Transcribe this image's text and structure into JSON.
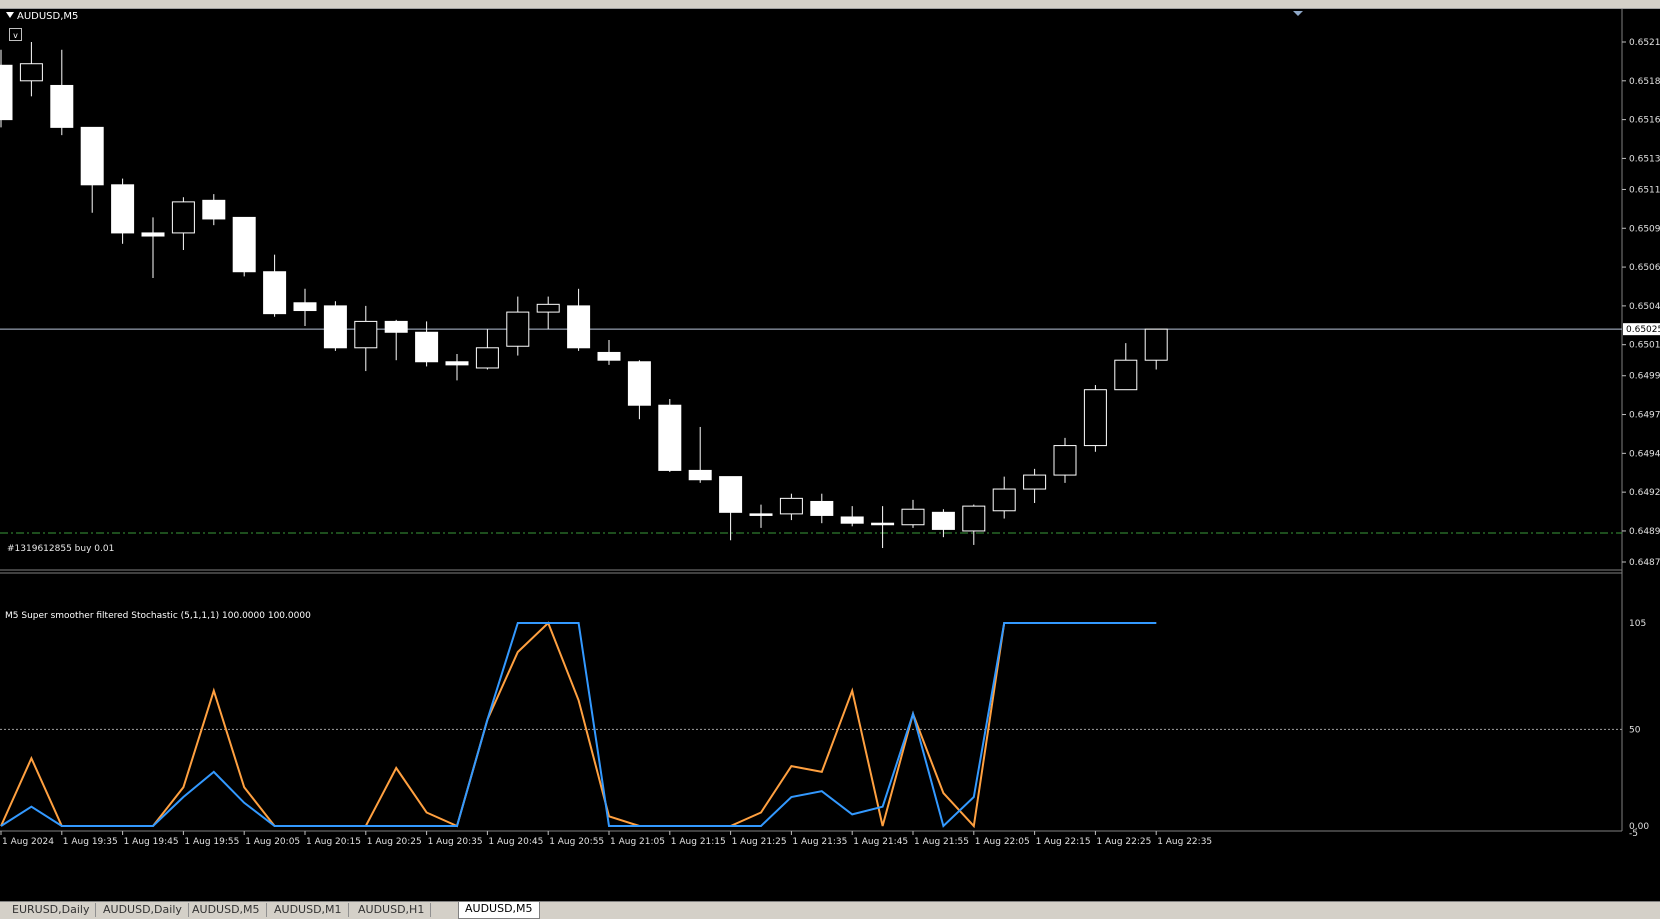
{
  "window": {
    "symbol_title": "AUDUSD,M5",
    "oneclick_toggle": "v"
  },
  "price_axis": {
    "labels": [
      "0.65210",
      "0.65185",
      "0.65160",
      "0.65135",
      "0.65115",
      "0.65090",
      "0.65065",
      "0.65040",
      "0.65015",
      "0.64995",
      "0.64970",
      "0.64945",
      "0.64920",
      "0.64895",
      "0.64875"
    ],
    "current_price": "0.65025"
  },
  "order_line": {
    "label": "#1319612855 buy 0.01",
    "color": "#3a9a3a"
  },
  "indicator": {
    "label": "M5 Super smoother filtered Stochastic (5,1,1,1) 100.0000 100.0000",
    "scale_labels": [
      "105",
      "50",
      "0.00",
      "-5"
    ],
    "main_color": "#3399ff",
    "signal_color": "#ffa040",
    "main_values": [
      0,
      10,
      0,
      0,
      0,
      0,
      15,
      28,
      12,
      0,
      0,
      0,
      0,
      0,
      0,
      0,
      55,
      106,
      106,
      106,
      0,
      0,
      0,
      0,
      0,
      0,
      15,
      18,
      6,
      10,
      58,
      0,
      15,
      106,
      106,
      106,
      106,
      106,
      106
    ],
    "signal_values": [
      0,
      35,
      0,
      0,
      0,
      0,
      20,
      70,
      20,
      0,
      0,
      0,
      0,
      30,
      7,
      0,
      55,
      90,
      106,
      65,
      5,
      0,
      0,
      0,
      0,
      7,
      31,
      28,
      70,
      0,
      58,
      17,
      0,
      106,
      106,
      106,
      106,
      106,
      106
    ]
  },
  "time_axis": {
    "labels": [
      "1 Aug 2024",
      "1 Aug 19:35",
      "1 Aug 19:45",
      "1 Aug 19:55",
      "1 Aug 20:05",
      "1 Aug 20:15",
      "1 Aug 20:25",
      "1 Aug 20:35",
      "1 Aug 20:45",
      "1 Aug 20:55",
      "1 Aug 21:05",
      "1 Aug 21:15",
      "1 Aug 21:25",
      "1 Aug 21:35",
      "1 Aug 21:45",
      "1 Aug 21:55",
      "1 Aug 22:05",
      "1 Aug 22:15",
      "1 Aug 22:25",
      "1 Aug 22:35"
    ]
  },
  "candles": [
    {
      "o": 0.65195,
      "h": 0.65205,
      "l": 0.65155,
      "c": 0.6516
    },
    {
      "o": 0.65185,
      "h": 0.6521,
      "l": 0.65175,
      "c": 0.65196
    },
    {
      "o": 0.65182,
      "h": 0.65205,
      "l": 0.6515,
      "c": 0.65155
    },
    {
      "o": 0.65155,
      "h": 0.65155,
      "l": 0.651,
      "c": 0.65118
    },
    {
      "o": 0.65118,
      "h": 0.65122,
      "l": 0.6508,
      "c": 0.65087
    },
    {
      "o": 0.65087,
      "h": 0.65097,
      "l": 0.65058,
      "c": 0.65085
    },
    {
      "o": 0.65087,
      "h": 0.6511,
      "l": 0.65076,
      "c": 0.65107
    },
    {
      "o": 0.65108,
      "h": 0.65112,
      "l": 0.65092,
      "c": 0.65096
    },
    {
      "o": 0.65097,
      "h": 0.65097,
      "l": 0.65059,
      "c": 0.65062
    },
    {
      "o": 0.65062,
      "h": 0.65073,
      "l": 0.65033,
      "c": 0.65035
    },
    {
      "o": 0.65042,
      "h": 0.65051,
      "l": 0.65027,
      "c": 0.65037
    },
    {
      "o": 0.6504,
      "h": 0.65043,
      "l": 0.65011,
      "c": 0.65013
    },
    {
      "o": 0.65013,
      "h": 0.6504,
      "l": 0.64998,
      "c": 0.6503
    },
    {
      "o": 0.6503,
      "h": 0.65031,
      "l": 0.65005,
      "c": 0.65023
    },
    {
      "o": 0.65023,
      "h": 0.6503,
      "l": 0.65001,
      "c": 0.65004
    },
    {
      "o": 0.65004,
      "h": 0.65009,
      "l": 0.64992,
      "c": 0.65002
    },
    {
      "o": 0.65,
      "h": 0.65025,
      "l": 0.64999,
      "c": 0.65013
    },
    {
      "o": 0.65014,
      "h": 0.65046,
      "l": 0.65008,
      "c": 0.65036
    },
    {
      "o": 0.65036,
      "h": 0.65046,
      "l": 0.65025,
      "c": 0.65041
    },
    {
      "o": 0.6504,
      "h": 0.65051,
      "l": 0.65011,
      "c": 0.65013
    },
    {
      "o": 0.6501,
      "h": 0.65018,
      "l": 0.65002,
      "c": 0.65005
    },
    {
      "o": 0.65004,
      "h": 0.65005,
      "l": 0.64967,
      "c": 0.64976
    },
    {
      "o": 0.64976,
      "h": 0.6498,
      "l": 0.64933,
      "c": 0.64934
    },
    {
      "o": 0.64934,
      "h": 0.64962,
      "l": 0.64926,
      "c": 0.64928
    },
    {
      "o": 0.6493,
      "h": 0.6493,
      "l": 0.64889,
      "c": 0.64907
    },
    {
      "o": 0.64906,
      "h": 0.64912,
      "l": 0.64897,
      "c": 0.64905
    },
    {
      "o": 0.64906,
      "h": 0.64919,
      "l": 0.64902,
      "c": 0.64916
    },
    {
      "o": 0.64914,
      "h": 0.64919,
      "l": 0.649,
      "c": 0.64905
    },
    {
      "o": 0.64904,
      "h": 0.64911,
      "l": 0.64898,
      "c": 0.649
    },
    {
      "o": 0.649,
      "h": 0.64911,
      "l": 0.64884,
      "c": 0.64899
    },
    {
      "o": 0.64899,
      "h": 0.64915,
      "l": 0.64897,
      "c": 0.64909
    },
    {
      "o": 0.64907,
      "h": 0.64909,
      "l": 0.64891,
      "c": 0.64896
    },
    {
      "o": 0.64895,
      "h": 0.64912,
      "l": 0.64886,
      "c": 0.64911
    },
    {
      "o": 0.64908,
      "h": 0.6493,
      "l": 0.64903,
      "c": 0.64922
    },
    {
      "o": 0.64922,
      "h": 0.64935,
      "l": 0.64913,
      "c": 0.64931
    },
    {
      "o": 0.64931,
      "h": 0.64955,
      "l": 0.64926,
      "c": 0.6495
    },
    {
      "o": 0.6495,
      "h": 0.64989,
      "l": 0.64946,
      "c": 0.64986
    },
    {
      "o": 0.64986,
      "h": 0.65016,
      "l": 0.64986,
      "c": 0.65005
    },
    {
      "o": 0.65005,
      "h": 0.65025,
      "l": 0.64999,
      "c": 0.65025
    }
  ],
  "colors": {
    "background": "#000000",
    "candle_up": "#000000",
    "candle_down": "#ffffff",
    "candle_outline": "#ffffff",
    "grid_level": "#b8c4d8",
    "current_price_tag": "#ffffff"
  },
  "tabs": [
    {
      "label": "EURUSD,Daily",
      "active": false
    },
    {
      "label": "AUDUSD,Daily",
      "active": false
    },
    {
      "label": "AUDUSD,M5",
      "active": false
    },
    {
      "label": "AUDUSD,M1",
      "active": false
    },
    {
      "label": "AUDUSD,H1",
      "active": false
    },
    {
      "label": "AUDUSD,M5",
      "active": true
    }
  ]
}
